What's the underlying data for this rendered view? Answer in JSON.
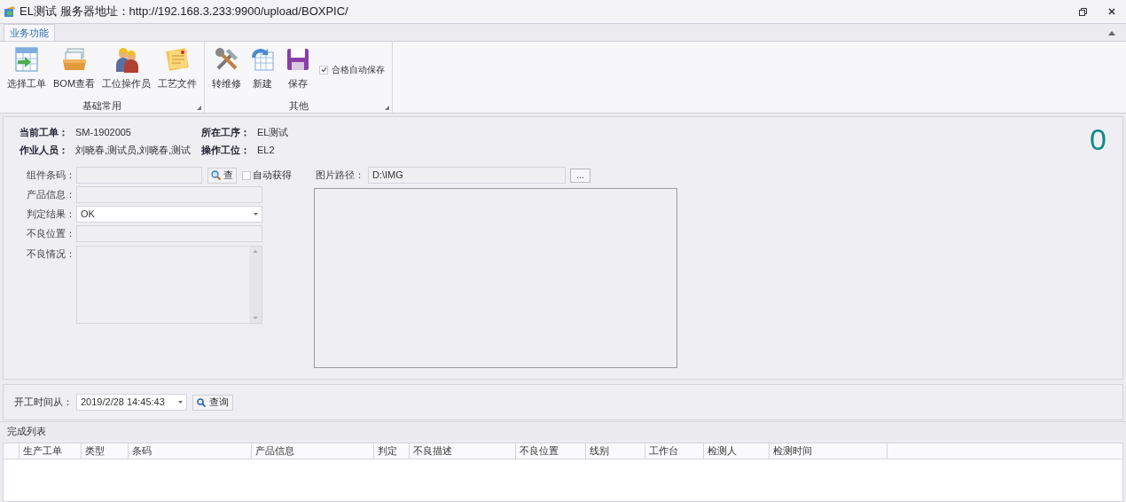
{
  "window": {
    "title": "EL测试 服务器地址：http://192.168.3.233:9900/upload/BOXPIC/"
  },
  "ribbon": {
    "tabs": [
      {
        "label": "业务功能",
        "selected": true
      }
    ],
    "groups": [
      {
        "label": "基础常用",
        "items": [
          {
            "kind": "button",
            "label": "选择工单"
          },
          {
            "kind": "button",
            "label": "BOM查看"
          },
          {
            "kind": "button",
            "label": "工位操作员"
          },
          {
            "kind": "button",
            "label": "工艺文件"
          }
        ]
      },
      {
        "label": "其他",
        "items": [
          {
            "kind": "button",
            "label": "转维修"
          },
          {
            "kind": "button",
            "label": "新建"
          },
          {
            "kind": "button",
            "label": "保存"
          },
          {
            "kind": "checkbox",
            "label": "合格自动保存",
            "checked": true
          }
        ]
      }
    ]
  },
  "order_info": [
    {
      "label": "当前工单：",
      "value": "SM-1902005"
    },
    {
      "label": "所在工序：",
      "value": "EL测试"
    },
    {
      "label": "作业人员：",
      "value": "刘晓春,测试员,刘晓春,测试"
    },
    {
      "label": "操作工位：",
      "value": "EL2"
    }
  ],
  "counter": "0",
  "form": [
    {
      "kind": "search",
      "label": "组件条码：",
      "button": "查",
      "checkbox": {
        "label": "自动获得",
        "checked": false
      }
    },
    {
      "kind": "text",
      "label": "产品信息："
    },
    {
      "kind": "select",
      "label": "判定结果：",
      "value": "OK"
    },
    {
      "kind": "text",
      "label": "不良位置："
    },
    {
      "kind": "memo",
      "label": "不良情况："
    }
  ],
  "image": {
    "label": "图片路径：",
    "value": "D:\\IMG",
    "browse_button": "..."
  },
  "query": {
    "label": "开工时间从：",
    "value": "2019/2/28 14:45:43",
    "button": "查询"
  },
  "completed_list": {
    "title": "完成列表",
    "columns": [
      "生产工单",
      "类型",
      "条码",
      "产品信息",
      "判定",
      "不良描述",
      "不良位置",
      "线别",
      "工作台",
      "检测人",
      "检测时间"
    ]
  }
}
